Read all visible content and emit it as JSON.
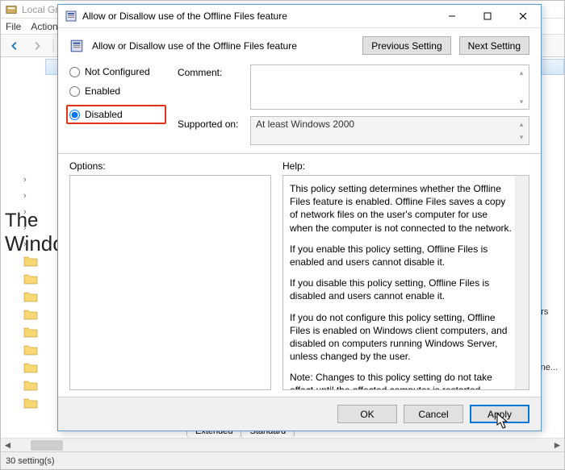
{
  "main_window": {
    "title": "Local Group Policy Editor",
    "menu": [
      "File",
      "Action"
    ],
    "status": "30 setting(s)",
    "tabs": [
      "Extended",
      "Standard"
    ],
    "side_items": [
      "lders",
      "signe..."
    ]
  },
  "watermark": {
    "line1": "The",
    "line2": "WindowsClub"
  },
  "dialog": {
    "title": "Allow or Disallow use of the Offline Files feature",
    "heading": "Allow or Disallow use of the Offline Files feature",
    "prev_btn": "Previous Setting",
    "next_btn": "Next Setting",
    "radios": {
      "not_configured": "Not Configured",
      "enabled": "Enabled",
      "disabled": "Disabled",
      "selected": "disabled"
    },
    "comment_label": "Comment:",
    "comment_value": "",
    "supported_label": "Supported on:",
    "supported_value": "At least Windows 2000",
    "options_label": "Options:",
    "help_label": "Help:",
    "help_paragraphs": [
      "This policy setting determines whether the Offline Files feature is enabled. Offline Files saves a copy of network files on the user's computer for use when the computer is not connected to the network.",
      "If you enable this policy setting, Offline Files is enabled and users cannot disable it.",
      "If you disable this policy setting, Offline Files is disabled and users cannot enable it.",
      "If you do not configure this policy setting, Offline Files is enabled on Windows client computers, and disabled on computers running Windows Server, unless changed by the user.",
      "Note: Changes to this policy setting do not take effect until the affected computer is restarted."
    ],
    "ok_btn": "OK",
    "cancel_btn": "Cancel",
    "apply_btn": "Apply"
  }
}
